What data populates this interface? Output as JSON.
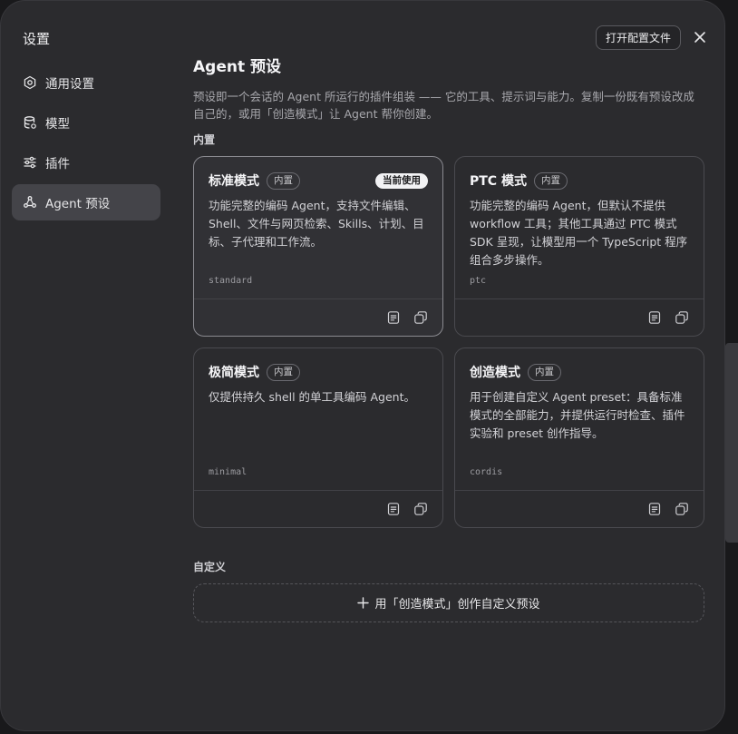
{
  "window": {
    "title": "设置",
    "open_config_label": "打开配置文件"
  },
  "sidebar": {
    "items": [
      {
        "label": "通用设置",
        "icon": "gear-icon",
        "active": false
      },
      {
        "label": "模型",
        "icon": "database-icon",
        "active": false
      },
      {
        "label": "插件",
        "icon": "sliders-icon",
        "active": false
      },
      {
        "label": "Agent 预设",
        "icon": "agent-icon",
        "active": true
      }
    ]
  },
  "main": {
    "title": "Agent 预设",
    "description": "预设即一个会话的 Agent 所运行的插件组装 —— 它的工具、提示词与能力。复制一份既有预设改成自己的，或用「创造模式」让 Agent 帮你创建。",
    "builtin_label": "内置",
    "builtin_badge": "内置",
    "current_badge": "当前使用",
    "presets": [
      {
        "name": "标准模式",
        "desc": "功能完整的编码 Agent，支持文件编辑、Shell、文件与网页检索、Skills、计划、目标、子代理和工作流。",
        "id": "standard"
      },
      {
        "name": "PTC 模式",
        "desc": "功能完整的编码 Agent，但默认不提供 workflow 工具；其他工具通过 PTC 模式 SDK 呈现，让模型用一个 TypeScript 程序组合多步操作。",
        "id": "ptc"
      },
      {
        "name": "极简模式",
        "desc": "仅提供持久 shell 的单工具编码 Agent。",
        "id": "minimal"
      },
      {
        "name": "创造模式",
        "desc": "用于创建自定义 Agent preset：具备标准模式的全部能力，并提供运行时检查、插件实验和 preset 创作指导。",
        "id": "cordis"
      }
    ],
    "custom_label": "自定义",
    "create_button": "用「创造模式」创作自定义预设"
  }
}
